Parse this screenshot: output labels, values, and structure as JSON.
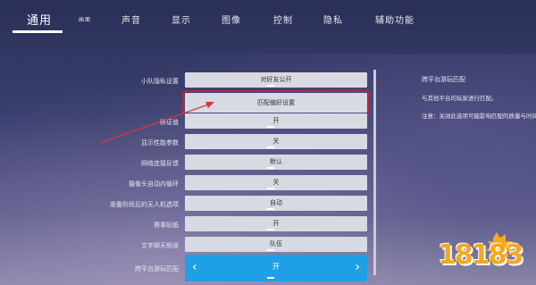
{
  "tabs": [
    {
      "label": "通用",
      "active": true
    },
    {
      "label": "画面"
    },
    {
      "label": "声音"
    },
    {
      "label": "显示"
    },
    {
      "label": "图像"
    },
    {
      "label": "控制"
    },
    {
      "label": "隐私"
    },
    {
      "label": "辅助功能"
    }
  ],
  "settings": [
    {
      "label": "小队隐私设置",
      "value": "对好友公开"
    },
    {
      "label": "",
      "value": "匹配偏好设置",
      "highlight": true
    },
    {
      "label": "移证值",
      "value": "开"
    },
    {
      "label": "显示性能参数",
      "value": "关"
    },
    {
      "label": "网络连接反馈",
      "value": "默认"
    },
    {
      "label": "摄像头自动内循环",
      "value": "关"
    },
    {
      "label": "准备阶段后的无人机选项",
      "value": "自动"
    },
    {
      "label": "赛事贴纸",
      "value": "开"
    },
    {
      "label": "文字聊天频道",
      "value": "队伍"
    },
    {
      "label": "跨平台游玩匹配",
      "value": "开",
      "active": true
    }
  ],
  "info": {
    "title": "跨平台游玩匹配",
    "line1": "与其他平台的玩家进行匹配。",
    "line2": "注意：关闭此选项可能影响匹配的质量与时间。"
  },
  "active_arrows": {
    "left": "‹",
    "right": "›"
  },
  "watermark": "18183",
  "colors": {
    "accent": "#1fa0e6",
    "highlight": "#c0233a",
    "annotation": "#d33a3a"
  }
}
